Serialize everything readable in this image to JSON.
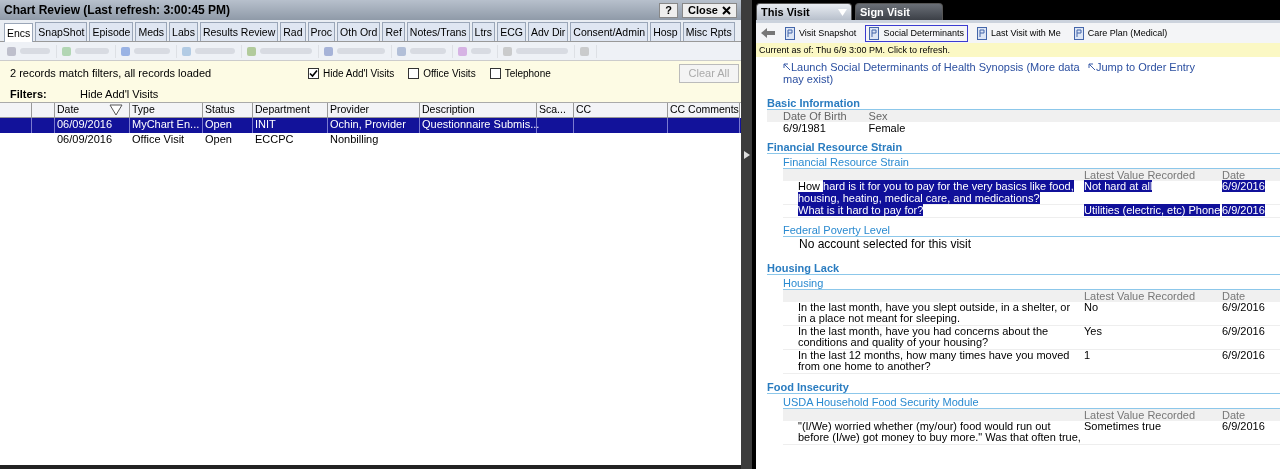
{
  "chart_review": {
    "title": "Chart Review (Last refresh: 3:00:45 PM)",
    "help": "?",
    "close": "Close",
    "tabs": [
      {
        "label": "Encs",
        "selected": true
      },
      {
        "label": "SnapShot",
        "selected": false
      },
      {
        "label": "Episode",
        "selected": false
      },
      {
        "label": "Meds",
        "selected": false
      },
      {
        "label": "Labs",
        "selected": false
      },
      {
        "label": "Results Review",
        "selected": false
      },
      {
        "label": "Rad",
        "selected": false
      },
      {
        "label": "Proc",
        "selected": false
      },
      {
        "label": "Oth Ord",
        "selected": false
      },
      {
        "label": "Ref",
        "selected": false
      },
      {
        "label": "Notes/Trans",
        "selected": false
      },
      {
        "label": "Ltrs",
        "selected": false
      },
      {
        "label": "ECG",
        "selected": false
      },
      {
        "label": "Adv Dir",
        "selected": false
      },
      {
        "label": "Consent/Admin",
        "selected": false
      },
      {
        "label": "Hosp",
        "selected": false
      },
      {
        "label": "Misc Rpts",
        "selected": false
      }
    ],
    "status": "2 records match filters, all records loaded",
    "checkboxes": [
      {
        "label": "Hide Add'l Visits",
        "checked": true
      },
      {
        "label": "Office Visits",
        "checked": false
      },
      {
        "label": "Telephone",
        "checked": false
      }
    ],
    "clear_all": "Clear All",
    "filters_label": "Filters:",
    "filters_value": "Hide Add'l Visits",
    "table": {
      "columns": [
        "Date",
        "Type",
        "Status",
        "Department",
        "Provider",
        "Description",
        "Sca...",
        "CC",
        "CC Comments"
      ],
      "rows": [
        {
          "selected": true,
          "cells": [
            "06/09/2016",
            "MyChart En...",
            "Open",
            "INIT",
            "Ochin, Provider",
            "Questionnaire Submis...",
            "",
            "",
            ""
          ]
        },
        {
          "selected": false,
          "cells": [
            "06/09/2016",
            "Office Visit",
            "Open",
            "ECCPC",
            "Nonbilling",
            "",
            "",
            "",
            ""
          ]
        }
      ]
    }
  },
  "visit": {
    "tabs": [
      {
        "label": "This Visit",
        "selected": true
      },
      {
        "label": "Sign Visit",
        "selected": false
      }
    ],
    "reports": [
      {
        "label": "Visit Snapshot",
        "selected": false
      },
      {
        "label": "Social Determinants",
        "selected": true
      },
      {
        "label": "Last Visit with Me",
        "selected": false
      },
      {
        "label": "Care Plan (Medical)",
        "selected": false
      }
    ],
    "current": "Current as of: Thu 6/9 3:00 PM. Click to refresh.",
    "links": [
      "Launch Social Determinants of Health Synopsis (More data may exist)",
      "Jump to Order Entry"
    ],
    "basic": {
      "heading": "Basic Information",
      "fields": [
        {
          "label": "Date Of Birth",
          "value": "6/9/1981"
        },
        {
          "label": "Sex",
          "value": "Female"
        }
      ]
    },
    "sections": [
      {
        "heading": "Financial Resource Strain",
        "groups": [
          {
            "title": "Financial Resource Strain",
            "value_header": "Latest Value Recorded",
            "date_header": "Date",
            "rows": [
              {
                "question": [
                  {
                    "text": "How ",
                    "highlighted": false
                  },
                  {
                    "text": "hard is it for you to pay for the very basics like food, housing, heating, medical care, and medications?",
                    "highlighted": true
                  }
                ],
                "value": "Not hard at all",
                "date": "6/9/2016",
                "highlighted": true
              },
              {
                "question": [
                  {
                    "text": "What is it hard to pay for?",
                    "highlighted": true
                  }
                ],
                "value": "Utilities (electric, etc) Phone",
                "date": "6/9/2016",
                "highlighted": true
              }
            ]
          },
          {
            "title": "Federal Poverty Level",
            "note": "No account selected for this visit"
          }
        ]
      },
      {
        "heading": "Housing Lack",
        "groups": [
          {
            "title": "Housing",
            "value_header": "Latest Value Recorded",
            "date_header": "Date",
            "rows": [
              {
                "question": [
                  {
                    "text": "In the last month, have you slept outside, in a shelter, or in a place not meant for sleeping.",
                    "highlighted": false
                  }
                ],
                "value": "No",
                "date": "6/9/2016",
                "highlighted": false
              },
              {
                "question": [
                  {
                    "text": "In the last month, have you had concerns about the conditions and quality of your housing?",
                    "highlighted": false
                  }
                ],
                "value": "Yes",
                "date": "6/9/2016",
                "highlighted": false
              },
              {
                "question": [
                  {
                    "text": "In the last 12 months, how many times have you moved from one home to another?",
                    "highlighted": false
                  }
                ],
                "value": "1",
                "date": "6/9/2016",
                "highlighted": false
              }
            ]
          }
        ]
      },
      {
        "heading": "Food Insecurity",
        "groups": [
          {
            "title": "USDA Household Food Security Module",
            "value_header": "Latest Value Recorded",
            "date_header": "Date",
            "rows": [
              {
                "question": [
                  {
                    "text": "\"(I/We) worried whether (my/our) food would run out before (I/we) got money to buy more.\"  Was that often true,",
                    "highlighted": false
                  }
                ],
                "value": "Sometimes true",
                "date": "6/9/2016",
                "highlighted": false
              }
            ]
          }
        ]
      }
    ]
  }
}
